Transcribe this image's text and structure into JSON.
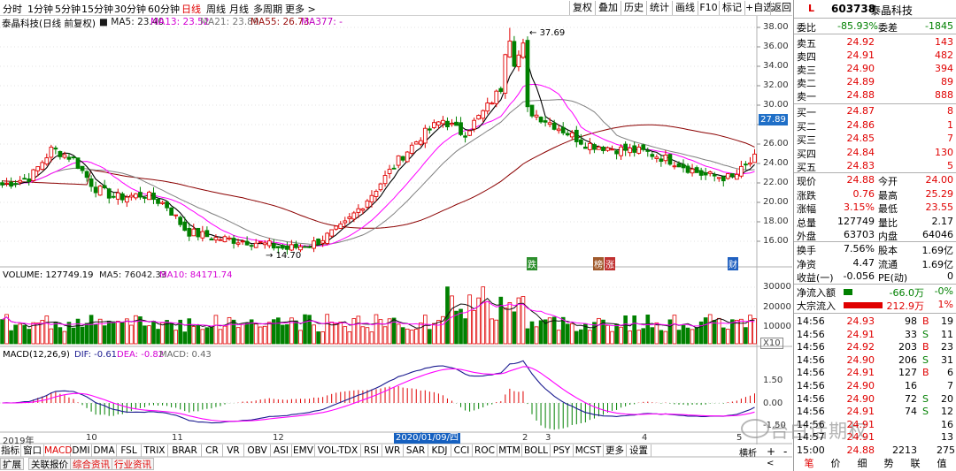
{
  "periods": [
    "分时",
    "1分钟",
    "5分钟",
    "15分钟",
    "30分钟",
    "60分钟",
    "日线",
    "周线",
    "月线",
    "多周期",
    "更多 >"
  ],
  "active_period": "日线",
  "toolbar_buttons": [
    "复权",
    "叠加",
    "历史",
    "统计",
    "画线",
    "F10",
    "标记",
    "+自选",
    "返回"
  ],
  "info": {
    "stock": "泰晶科技(日线 前复权)",
    "ma5": "MA5: 23.40",
    "ma13": "MA13: 23.52",
    "ma21": "MA21: 23.89",
    "ma55": "MA55: 26.73",
    "ma377": "MA377: -"
  },
  "price_axis": [
    "38.00",
    "36.00",
    "34.00",
    "32.00",
    "30.00",
    "28.00",
    "26.00",
    "24.00",
    "22.00",
    "20.00",
    "18.00",
    "16.00"
  ],
  "current_price_tag": "27.89",
  "high_label": "37.69",
  "low_label": "14.70",
  "markers": [
    "跌",
    "榜",
    "涨",
    "财"
  ],
  "volume": {
    "label": "VOLUME: 127749.19",
    "ma5": "MA5: 76042.33",
    "ma10": "MA10: 84171.74",
    "axis": [
      "30000",
      "20000",
      "10000"
    ],
    "unit": "X10"
  },
  "macd": {
    "label": "MACD(12,26,9)",
    "dif": "DIF: -0.61",
    "dea": "DEA: -0.82",
    "macd": "MACD: 0.43",
    "axis": [
      "1.50",
      "0.00",
      "-1.50"
    ]
  },
  "date_axis": [
    "2019年",
    "10",
    "11",
    "12",
    "2",
    "3",
    "4",
    "5"
  ],
  "current_date": "2020/01/09/四",
  "indicators": [
    "指标",
    "窗口",
    "MACD",
    "DMI",
    "DMA",
    "FSL",
    "TRIX",
    "BRAR",
    "CR",
    "VR",
    "OBV",
    "ASI",
    "EMV",
    "VOL-TDX",
    "RSI",
    "WR",
    "SAR",
    "KDJ",
    "CCI",
    "ROC",
    "MTM",
    "BOLL",
    "PSY",
    "MCST",
    "更多",
    "设置"
  ],
  "active_indicator": "MACD",
  "bottom_tabs": [
    "扩展",
    "关联报价",
    "综合资讯",
    "行业资讯"
  ],
  "bottom_right": {
    "mode": "横析",
    "plus": "+",
    "minus": "-",
    "nav": "<"
  },
  "panel": {
    "badge": "L",
    "code": "603738",
    "name": "泰晶科技",
    "weibi_label": "委比",
    "weibi": "-85.93%",
    "weicha_label": "委差",
    "weicha": "-1845",
    "asks": [
      {
        "label": "卖五",
        "price": "24.92",
        "vol": "143"
      },
      {
        "label": "卖四",
        "price": "24.91",
        "vol": "482"
      },
      {
        "label": "卖三",
        "price": "24.90",
        "vol": "394"
      },
      {
        "label": "卖二",
        "price": "24.89",
        "vol": "89"
      },
      {
        "label": "卖一",
        "price": "24.88",
        "vol": "888"
      }
    ],
    "bids": [
      {
        "label": "买一",
        "price": "24.87",
        "vol": "8"
      },
      {
        "label": "买二",
        "price": "24.86",
        "vol": "1"
      },
      {
        "label": "买三",
        "price": "24.85",
        "vol": "7"
      },
      {
        "label": "买四",
        "price": "24.84",
        "vol": "130"
      },
      {
        "label": "买五",
        "price": "24.83",
        "vol": "5"
      }
    ],
    "stats": [
      {
        "l1": "现价",
        "v1": "24.88",
        "l2": "今开",
        "v2": "24.00"
      },
      {
        "l1": "涨跌",
        "v1": "0.76",
        "l2": "最高",
        "v2": "25.29"
      },
      {
        "l1": "涨幅",
        "v1": "3.15%",
        "l2": "最低",
        "v2": "23.55"
      },
      {
        "l1": "总量",
        "v1": "127749",
        "l2": "量比",
        "v2": "2.17"
      },
      {
        "l1": "外盘",
        "v1": "63703",
        "l2": "内盘",
        "v2": "64046"
      }
    ],
    "stats2": [
      {
        "l1": "换手",
        "v1": "7.56%",
        "l2": "股本",
        "v2": "1.69亿"
      },
      {
        "l1": "净资",
        "v1": "4.47",
        "l2": "流通",
        "v2": "1.69亿"
      },
      {
        "l1": "收益(一)",
        "v1": "-0.056",
        "l2": "PE(动)",
        "v2": "0"
      }
    ],
    "flows": [
      {
        "label": "净流入额",
        "value": "-66.0万",
        "pct": "-0%"
      },
      {
        "label": "大宗流入",
        "value": "212.9万",
        "pct": "1%"
      }
    ],
    "trades": [
      {
        "t": "14:56",
        "p": "24.93",
        "v": "98",
        "d": "B",
        "n": "19"
      },
      {
        "t": "14:56",
        "p": "24.91",
        "v": "33",
        "d": "S",
        "n": "11"
      },
      {
        "t": "14:56",
        "p": "24.92",
        "v": "203",
        "d": "B",
        "n": "23"
      },
      {
        "t": "14:56",
        "p": "24.90",
        "v": "206",
        "d": "S",
        "n": "31"
      },
      {
        "t": "14:56",
        "p": "24.91",
        "v": "127",
        "d": "B",
        "n": "6"
      },
      {
        "t": "14:56",
        "p": "24.90",
        "v": "16",
        "d": "",
        "n": "7"
      },
      {
        "t": "14:56",
        "p": "24.90",
        "v": "72",
        "d": "S",
        "n": "20"
      },
      {
        "t": "14:56",
        "p": "24.91",
        "v": "74",
        "d": "S",
        "n": "12"
      },
      {
        "t": "14:56",
        "p": "24.91",
        "v": "",
        "d": "",
        "n": "16"
      },
      {
        "t": "14:57",
        "p": "24.91",
        "v": "",
        "d": "",
        "n": "13"
      },
      {
        "t": "15:00",
        "p": "24.88",
        "v": "2213",
        "d": "",
        "n": "275"
      }
    ],
    "tabs": [
      "笔",
      "价",
      "细",
      "势",
      "联",
      "值"
    ]
  },
  "watermark": "台白话期权",
  "colors": {
    "up": "#e00000",
    "down": "#008000",
    "ma5": "#000000",
    "ma13": "#ff00ff",
    "ma21": "#808080",
    "ma55": "#8b0000",
    "dif": "#1a1a8f",
    "dea": "#ff00ff"
  }
}
